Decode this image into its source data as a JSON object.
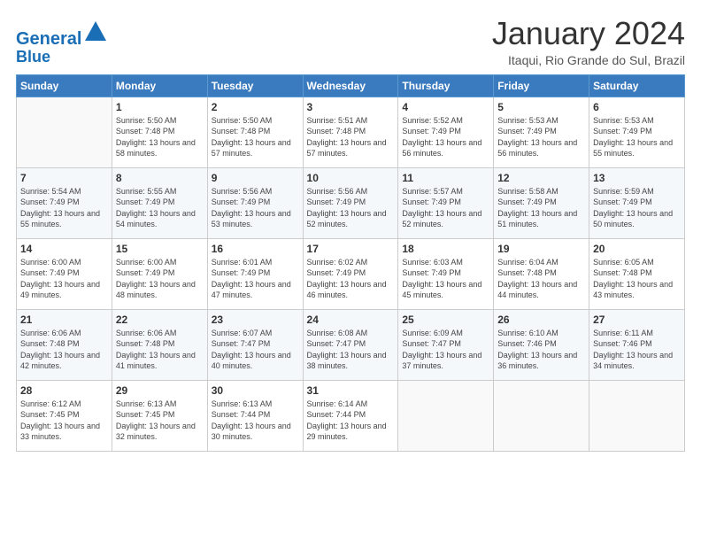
{
  "header": {
    "logo_line1": "General",
    "logo_line2": "Blue",
    "title": "January 2024",
    "location": "Itaqui, Rio Grande do Sul, Brazil"
  },
  "columns": [
    "Sunday",
    "Monday",
    "Tuesday",
    "Wednesday",
    "Thursday",
    "Friday",
    "Saturday"
  ],
  "weeks": [
    [
      {
        "day": "",
        "sunrise": "",
        "sunset": "",
        "daylight": ""
      },
      {
        "day": "1",
        "sunrise": "Sunrise: 5:50 AM",
        "sunset": "Sunset: 7:48 PM",
        "daylight": "Daylight: 13 hours and 58 minutes."
      },
      {
        "day": "2",
        "sunrise": "Sunrise: 5:50 AM",
        "sunset": "Sunset: 7:48 PM",
        "daylight": "Daylight: 13 hours and 57 minutes."
      },
      {
        "day": "3",
        "sunrise": "Sunrise: 5:51 AM",
        "sunset": "Sunset: 7:48 PM",
        "daylight": "Daylight: 13 hours and 57 minutes."
      },
      {
        "day": "4",
        "sunrise": "Sunrise: 5:52 AM",
        "sunset": "Sunset: 7:49 PM",
        "daylight": "Daylight: 13 hours and 56 minutes."
      },
      {
        "day": "5",
        "sunrise": "Sunrise: 5:53 AM",
        "sunset": "Sunset: 7:49 PM",
        "daylight": "Daylight: 13 hours and 56 minutes."
      },
      {
        "day": "6",
        "sunrise": "Sunrise: 5:53 AM",
        "sunset": "Sunset: 7:49 PM",
        "daylight": "Daylight: 13 hours and 55 minutes."
      }
    ],
    [
      {
        "day": "7",
        "sunrise": "Sunrise: 5:54 AM",
        "sunset": "Sunset: 7:49 PM",
        "daylight": "Daylight: 13 hours and 55 minutes."
      },
      {
        "day": "8",
        "sunrise": "Sunrise: 5:55 AM",
        "sunset": "Sunset: 7:49 PM",
        "daylight": "Daylight: 13 hours and 54 minutes."
      },
      {
        "day": "9",
        "sunrise": "Sunrise: 5:56 AM",
        "sunset": "Sunset: 7:49 PM",
        "daylight": "Daylight: 13 hours and 53 minutes."
      },
      {
        "day": "10",
        "sunrise": "Sunrise: 5:56 AM",
        "sunset": "Sunset: 7:49 PM",
        "daylight": "Daylight: 13 hours and 52 minutes."
      },
      {
        "day": "11",
        "sunrise": "Sunrise: 5:57 AM",
        "sunset": "Sunset: 7:49 PM",
        "daylight": "Daylight: 13 hours and 52 minutes."
      },
      {
        "day": "12",
        "sunrise": "Sunrise: 5:58 AM",
        "sunset": "Sunset: 7:49 PM",
        "daylight": "Daylight: 13 hours and 51 minutes."
      },
      {
        "day": "13",
        "sunrise": "Sunrise: 5:59 AM",
        "sunset": "Sunset: 7:49 PM",
        "daylight": "Daylight: 13 hours and 50 minutes."
      }
    ],
    [
      {
        "day": "14",
        "sunrise": "Sunrise: 6:00 AM",
        "sunset": "Sunset: 7:49 PM",
        "daylight": "Daylight: 13 hours and 49 minutes."
      },
      {
        "day": "15",
        "sunrise": "Sunrise: 6:00 AM",
        "sunset": "Sunset: 7:49 PM",
        "daylight": "Daylight: 13 hours and 48 minutes."
      },
      {
        "day": "16",
        "sunrise": "Sunrise: 6:01 AM",
        "sunset": "Sunset: 7:49 PM",
        "daylight": "Daylight: 13 hours and 47 minutes."
      },
      {
        "day": "17",
        "sunrise": "Sunrise: 6:02 AM",
        "sunset": "Sunset: 7:49 PM",
        "daylight": "Daylight: 13 hours and 46 minutes."
      },
      {
        "day": "18",
        "sunrise": "Sunrise: 6:03 AM",
        "sunset": "Sunset: 7:49 PM",
        "daylight": "Daylight: 13 hours and 45 minutes."
      },
      {
        "day": "19",
        "sunrise": "Sunrise: 6:04 AM",
        "sunset": "Sunset: 7:48 PM",
        "daylight": "Daylight: 13 hours and 44 minutes."
      },
      {
        "day": "20",
        "sunrise": "Sunrise: 6:05 AM",
        "sunset": "Sunset: 7:48 PM",
        "daylight": "Daylight: 13 hours and 43 minutes."
      }
    ],
    [
      {
        "day": "21",
        "sunrise": "Sunrise: 6:06 AM",
        "sunset": "Sunset: 7:48 PM",
        "daylight": "Daylight: 13 hours and 42 minutes."
      },
      {
        "day": "22",
        "sunrise": "Sunrise: 6:06 AM",
        "sunset": "Sunset: 7:48 PM",
        "daylight": "Daylight: 13 hours and 41 minutes."
      },
      {
        "day": "23",
        "sunrise": "Sunrise: 6:07 AM",
        "sunset": "Sunset: 7:47 PM",
        "daylight": "Daylight: 13 hours and 40 minutes."
      },
      {
        "day": "24",
        "sunrise": "Sunrise: 6:08 AM",
        "sunset": "Sunset: 7:47 PM",
        "daylight": "Daylight: 13 hours and 38 minutes."
      },
      {
        "day": "25",
        "sunrise": "Sunrise: 6:09 AM",
        "sunset": "Sunset: 7:47 PM",
        "daylight": "Daylight: 13 hours and 37 minutes."
      },
      {
        "day": "26",
        "sunrise": "Sunrise: 6:10 AM",
        "sunset": "Sunset: 7:46 PM",
        "daylight": "Daylight: 13 hours and 36 minutes."
      },
      {
        "day": "27",
        "sunrise": "Sunrise: 6:11 AM",
        "sunset": "Sunset: 7:46 PM",
        "daylight": "Daylight: 13 hours and 34 minutes."
      }
    ],
    [
      {
        "day": "28",
        "sunrise": "Sunrise: 6:12 AM",
        "sunset": "Sunset: 7:45 PM",
        "daylight": "Daylight: 13 hours and 33 minutes."
      },
      {
        "day": "29",
        "sunrise": "Sunrise: 6:13 AM",
        "sunset": "Sunset: 7:45 PM",
        "daylight": "Daylight: 13 hours and 32 minutes."
      },
      {
        "day": "30",
        "sunrise": "Sunrise: 6:13 AM",
        "sunset": "Sunset: 7:44 PM",
        "daylight": "Daylight: 13 hours and 30 minutes."
      },
      {
        "day": "31",
        "sunrise": "Sunrise: 6:14 AM",
        "sunset": "Sunset: 7:44 PM",
        "daylight": "Daylight: 13 hours and 29 minutes."
      },
      {
        "day": "",
        "sunrise": "",
        "sunset": "",
        "daylight": ""
      },
      {
        "day": "",
        "sunrise": "",
        "sunset": "",
        "daylight": ""
      },
      {
        "day": "",
        "sunrise": "",
        "sunset": "",
        "daylight": ""
      }
    ]
  ]
}
